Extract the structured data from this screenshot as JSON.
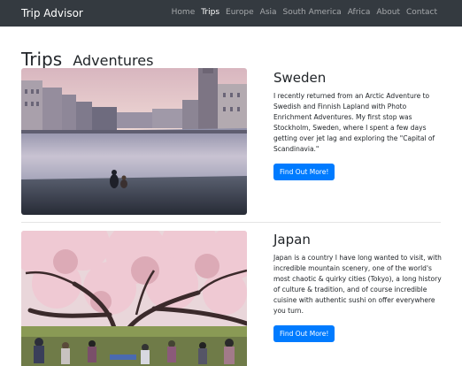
{
  "navbar": {
    "brand": "Trip Advisor",
    "links": [
      "Home",
      "Trips",
      "Europe",
      "Asia",
      "South America",
      "Africa",
      "About",
      "Contact"
    ],
    "active_index": 1
  },
  "heading": {
    "main": "Trips",
    "sub": "Adventures"
  },
  "trips": [
    {
      "title": "Sweden",
      "text": "I recently returned from an Arctic Adventure to Swedish and Finnish Lapland with Photo Enrichment Adventures. My first stop was Stockholm, Sweden, where I spent a few days getting over jet lag and exploring the \"Capital of Scandinavia.\"",
      "button": "Find Out More!"
    },
    {
      "title": "Japan",
      "text": "Japan is a country I have long wanted to visit, with incredible mountain scenery, one of the world's most chaotic & quirky cities (Tokyo), a long history of culture & tradition, and of course incredible cuisine with authentic sushi on offer everywhere you turn.",
      "button": "Find Out More!"
    }
  ],
  "colors": {
    "navbar_bg": "#343a40",
    "button_bg": "#007bff"
  }
}
